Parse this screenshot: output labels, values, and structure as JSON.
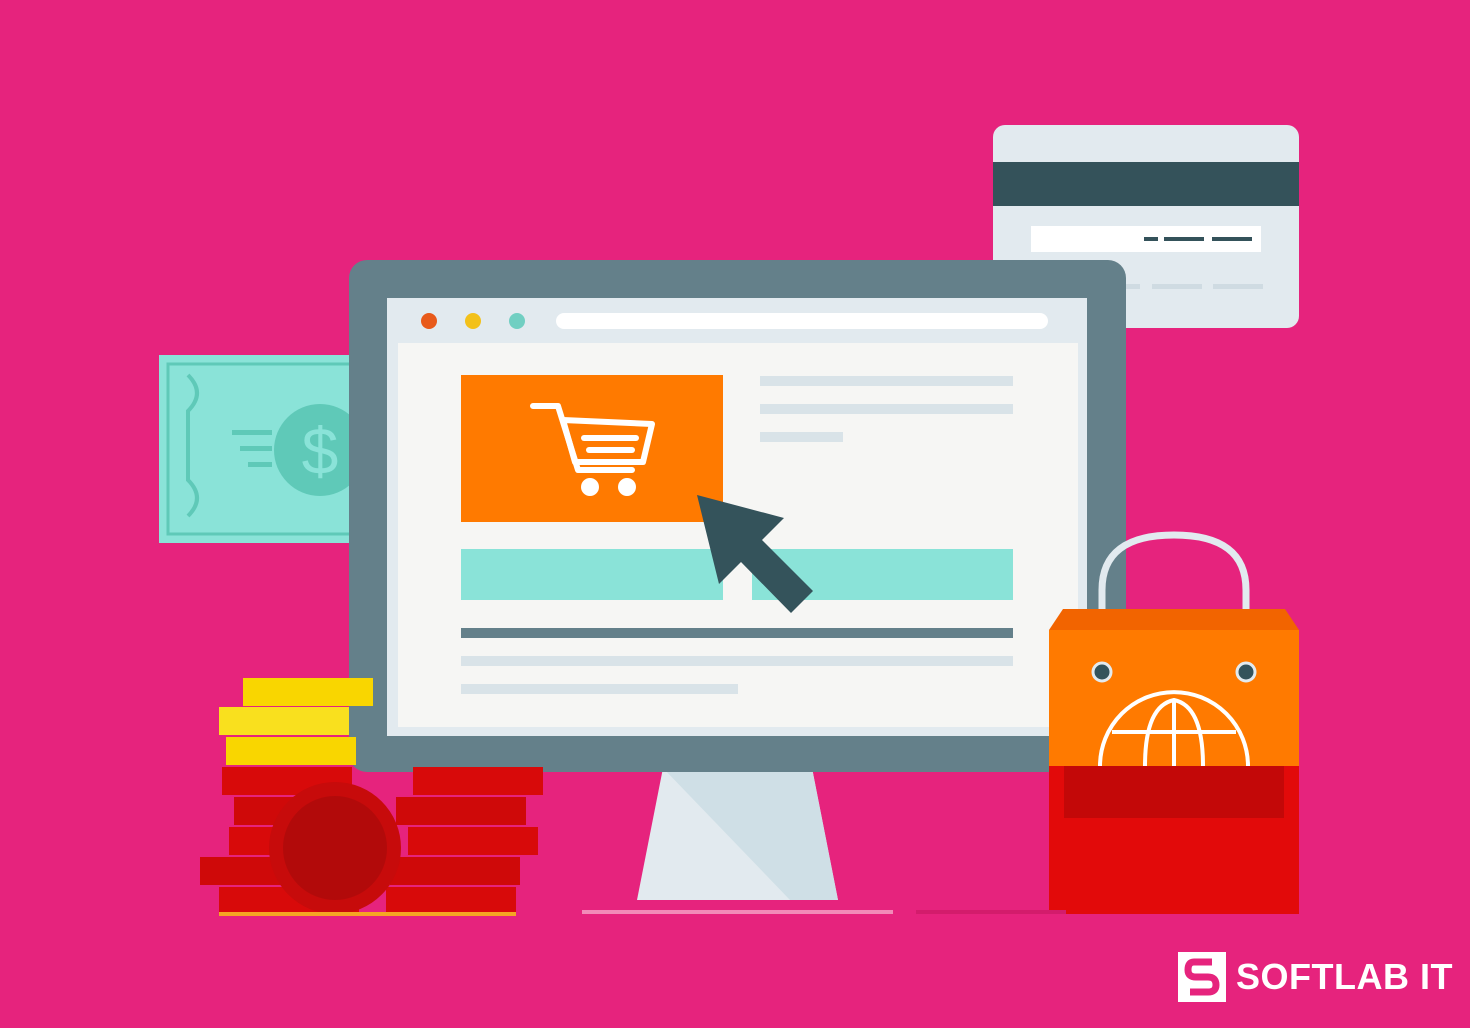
{
  "brand": {
    "name": "SOFTLAB IT",
    "logo_icon": "softlab-s-logo-icon"
  },
  "illustration": {
    "icons": [
      "credit-card-icon",
      "dollar-banknote-icon",
      "desktop-monitor-icon",
      "shopping-cart-icon",
      "mouse-cursor-icon",
      "coin-stack-icon",
      "shopping-bag-icon",
      "globe-icon"
    ]
  },
  "colors": {
    "background": "#e6237d",
    "accent_orange": "#ff7a00",
    "accent_teal": "#8ae3d8",
    "monitor_frame": "#64808a",
    "cursor": "#34535b",
    "coin_gold": "#f9d600",
    "coin_red": "#d80a0a"
  }
}
